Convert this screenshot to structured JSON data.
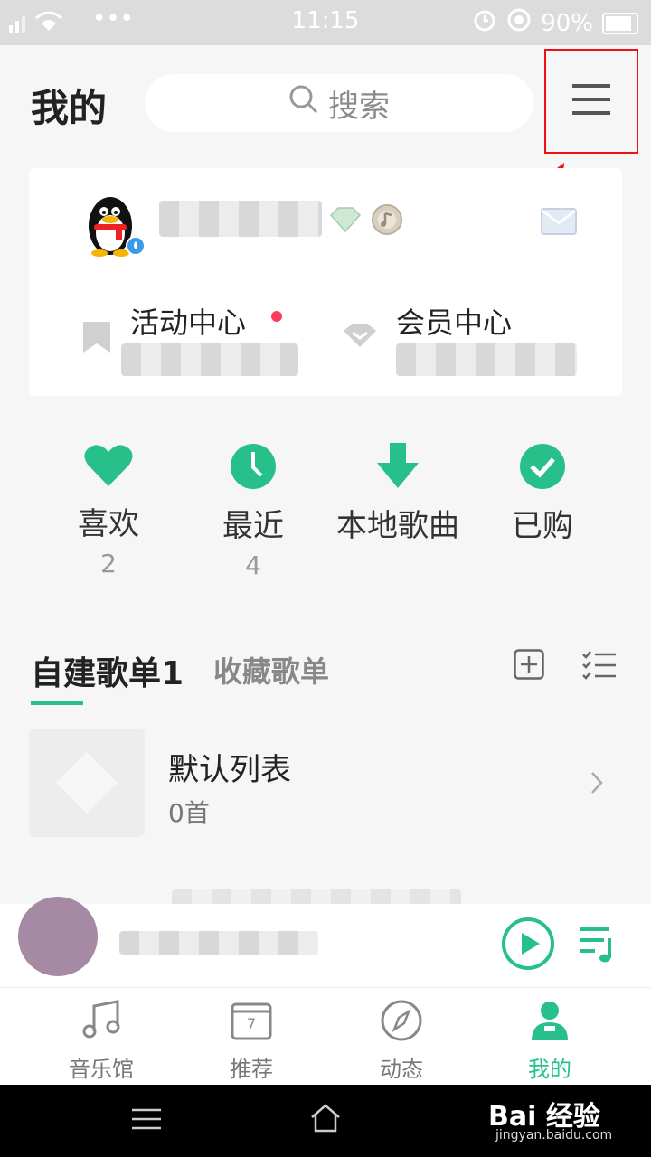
{
  "status_bar": {
    "time": "11:15",
    "left_dots": "•••",
    "battery_pct": "90%"
  },
  "header": {
    "title": "我的",
    "search_placeholder": "搜索"
  },
  "card": {
    "activity_label": "活动中心",
    "member_label": "会员中心"
  },
  "quick": [
    {
      "label": "喜欢",
      "count": "2"
    },
    {
      "label": "最近",
      "count": "4"
    },
    {
      "label": "本地歌曲",
      "count": ""
    },
    {
      "label": "已购",
      "count": ""
    }
  ],
  "playlists": {
    "tab_own": "自建歌单1",
    "tab_fav": "收藏歌单",
    "items": [
      {
        "name": "默认列表",
        "count": "0首"
      }
    ]
  },
  "nav": [
    {
      "label": "音乐馆"
    },
    {
      "label": "推荐",
      "icon_text": "7"
    },
    {
      "label": "动态"
    },
    {
      "label": "我的"
    }
  ],
  "watermark": {
    "brand": "Bai 经验",
    "url": "jingyan.baidu.com"
  },
  "colors": {
    "accent": "#27c08a",
    "highlight_box": "#ee1111",
    "dot": "#ff3b5c"
  }
}
